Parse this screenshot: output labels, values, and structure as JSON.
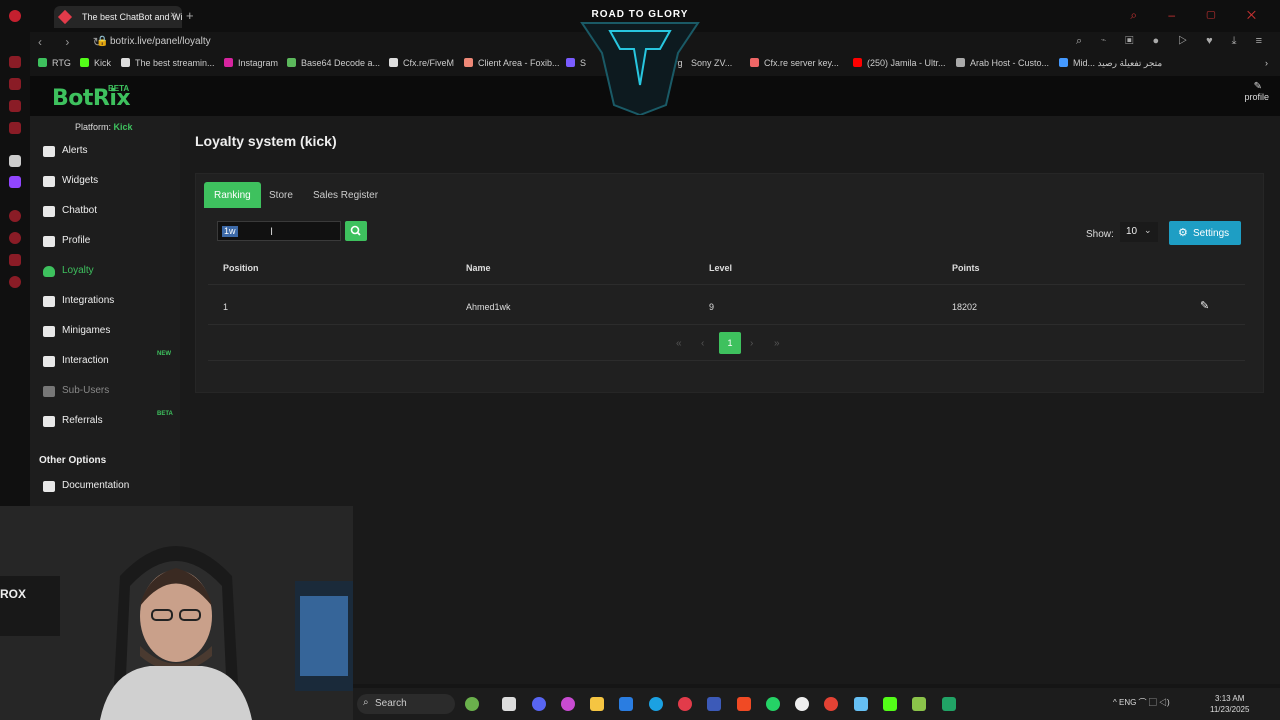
{
  "colors": {
    "accent": "#3ec15e",
    "settings": "#1e9ec4",
    "selection": "#3d6aa8"
  },
  "browser": {
    "tab_title": "The best ChatBot and Wid",
    "tab_close": "×",
    "new_tab": "+",
    "url": "botrix.live/panel/loyalty",
    "lock_icon": "🔒",
    "nav_glyphs": "‹ › ↻",
    "window_controls": "⌕ – ▢ ✕",
    "addr_icons": "⌕ ⌁ ▣ ● ▷ ♥ ⤓ ≡",
    "bookmarks": [
      {
        "label": "RTG",
        "color": "#3ec15e"
      },
      {
        "label": "Kick",
        "color": "#53fc18"
      },
      {
        "label": "The best streamin...",
        "color": "#ddd"
      },
      {
        "label": "Instagram",
        "color": "#d6249f"
      },
      {
        "label": "Base64 Decode a...",
        "color": "#5cb85c"
      },
      {
        "label": "Cfx.re/FiveM",
        "color": "#ddd"
      },
      {
        "label": "Client Area - Foxib...",
        "color": "#e87"
      },
      {
        "label": "S",
        "color": "#7a5cff"
      },
      {
        "label": "Urg",
        "color": "#777"
      },
      {
        "label": "Sony ZV...",
        "color": "#777"
      },
      {
        "label": "Cfx.re server key...",
        "color": "#e66"
      },
      {
        "label": "(250) Jamila - Ultr...",
        "color": "#f00"
      },
      {
        "label": "Arab Host - Custo...",
        "color": "#aaa"
      },
      {
        "label": "Mid... متجر تفعيلة رصيد",
        "color": "#49f"
      }
    ]
  },
  "overlay": {
    "text": "ROAD TO GLORY"
  },
  "app": {
    "logo": "BotRix",
    "logo_badge": "BETA",
    "profile_link": "profile",
    "profile_icon": "✎",
    "platform_label": "Platform: ",
    "platform_value": "Kick"
  },
  "sidebar": {
    "items": [
      {
        "label": "Alerts"
      },
      {
        "label": "Widgets"
      },
      {
        "label": "Chatbot"
      },
      {
        "label": "Profile"
      },
      {
        "label": "Loyalty"
      },
      {
        "label": "Integrations"
      },
      {
        "label": "Minigames"
      },
      {
        "label": "Interaction",
        "badge": "NEW"
      },
      {
        "label": "Sub-Users"
      },
      {
        "label": "Referrals",
        "badge": "BETA"
      }
    ],
    "section_title": "Other Options",
    "documentation": "Documentation"
  },
  "main": {
    "title": "Loyalty system (kick)",
    "tabs": [
      "Ranking",
      "Store",
      "Sales Register"
    ],
    "search_value": "1w",
    "search_icon": "⌕",
    "show_label": "Show:",
    "show_value": "10",
    "show_chevron": "⌄",
    "settings_label": "Settings",
    "settings_icon": "⚙",
    "table": {
      "headers": [
        "Position",
        "Name",
        "Level",
        "Points"
      ],
      "rows": [
        {
          "position": "1",
          "name": "Ahmed1wk",
          "level": "9",
          "points": "18202"
        }
      ]
    },
    "edit_icon": "✎",
    "pagination": {
      "first": "«",
      "prev": "‹",
      "current": "1",
      "next": "›",
      "last": "»"
    }
  },
  "taskbar": {
    "search": "Search",
    "tray": "^   ENG   ⌒ ▢ ◁)",
    "time": "3:13 AM",
    "date": "11/23/2025"
  }
}
